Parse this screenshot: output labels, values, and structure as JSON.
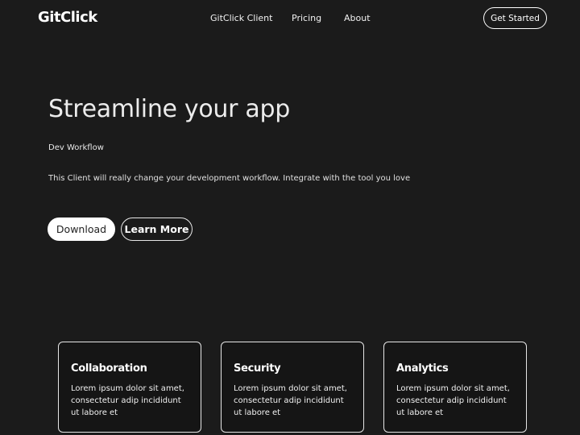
{
  "nav": {
    "logo": "GitClick",
    "links": [
      "GitClick Client",
      "Pricing",
      "About"
    ],
    "cta": "Get Started"
  },
  "hero": {
    "title": "Streamline your app",
    "subtitle": "Dev Workflow",
    "description": "This Client will really change your development workflow. Integrate with the tool you love",
    "download_label": "Download",
    "learn_more_label": "Learn More"
  },
  "features": [
    {
      "title": "Collaboration",
      "text": "Lorem ipsum dolor sit amet, consectetur adip incididunt ut labore et"
    },
    {
      "title": "Security",
      "text": "Lorem ipsum dolor sit amet, consectetur adip incididunt ut labore et"
    },
    {
      "title": "Analytics",
      "text": "Lorem ipsum dolor sit amet, consectetur adip incididunt ut labore et"
    }
  ],
  "colors": {
    "background": "#1b1b1b",
    "text": "#ffffff",
    "button_primary_bg": "#ffffff"
  }
}
